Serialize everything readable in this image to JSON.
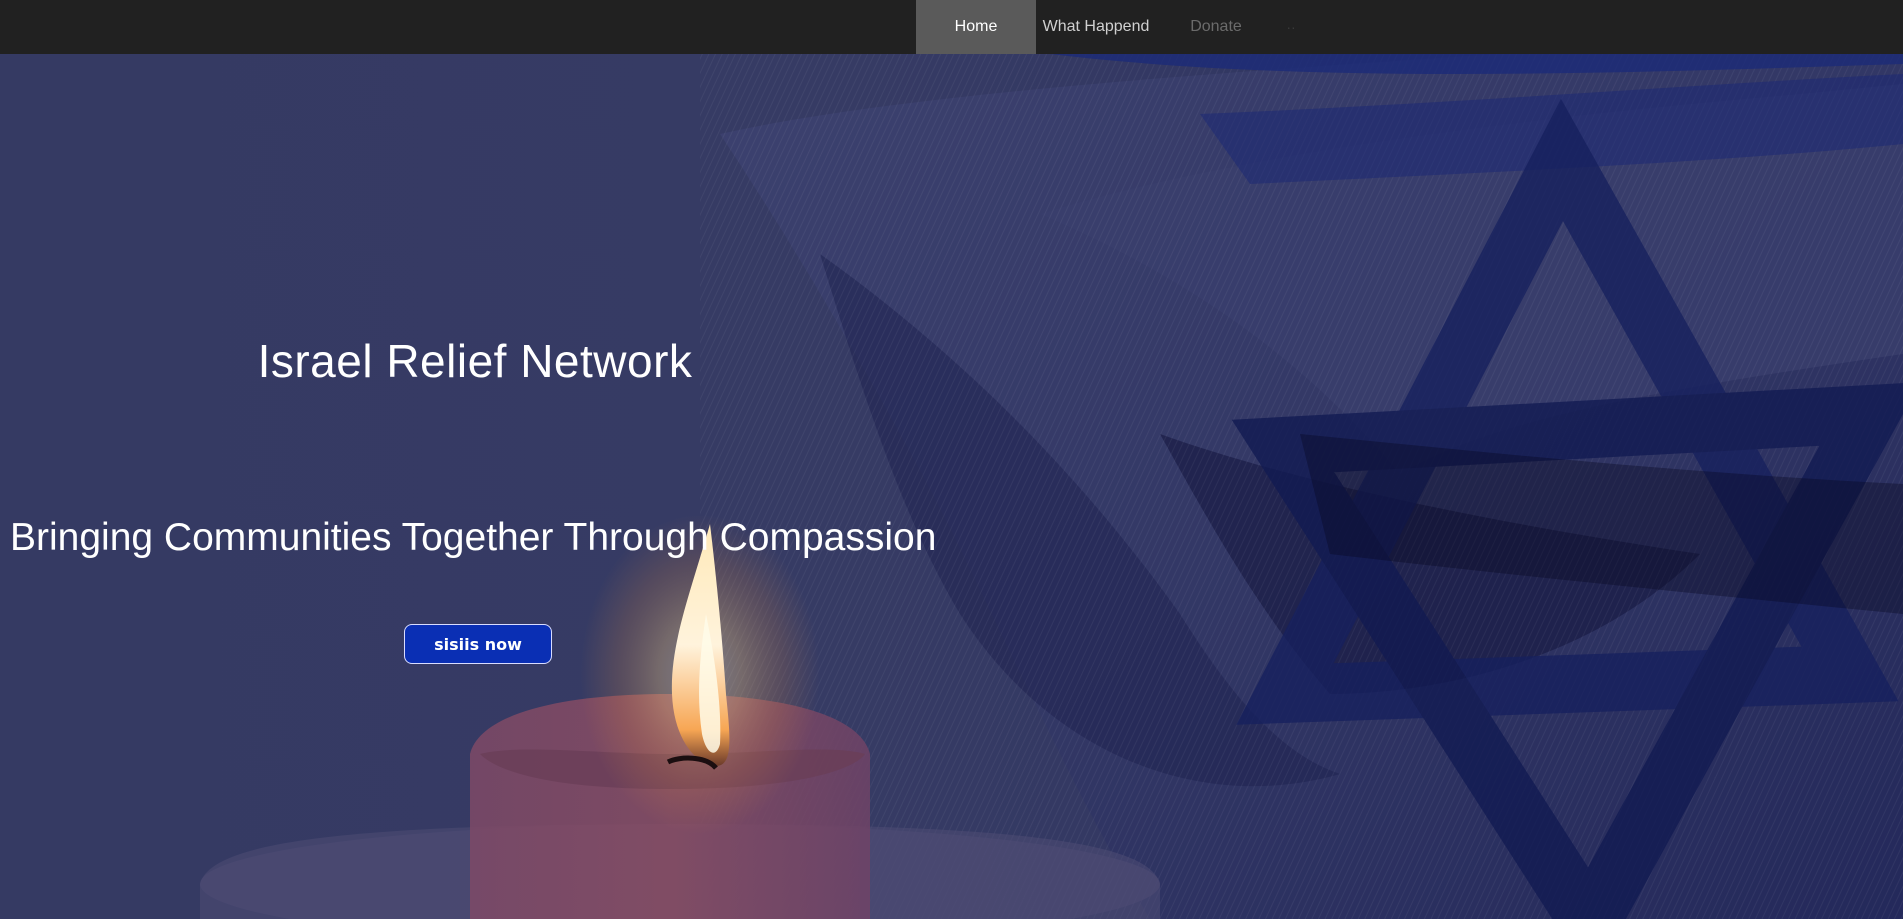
{
  "nav": {
    "items": [
      {
        "label": "Home",
        "active": true
      },
      {
        "label": "What Happend",
        "active": false
      },
      {
        "label": "Donate",
        "active": false
      },
      {
        "label": "··",
        "active": false
      }
    ]
  },
  "hero": {
    "title": "Israel Relief Network",
    "subtitle": "Bringing Communities Together Through Compassion",
    "cta_label": "sisiis now"
  },
  "colors": {
    "nav_bg": "#212121",
    "nav_active_bg": "#5a5a5a",
    "hero_overlay": "#363b63",
    "cta_bg": "#0a2fb4"
  }
}
